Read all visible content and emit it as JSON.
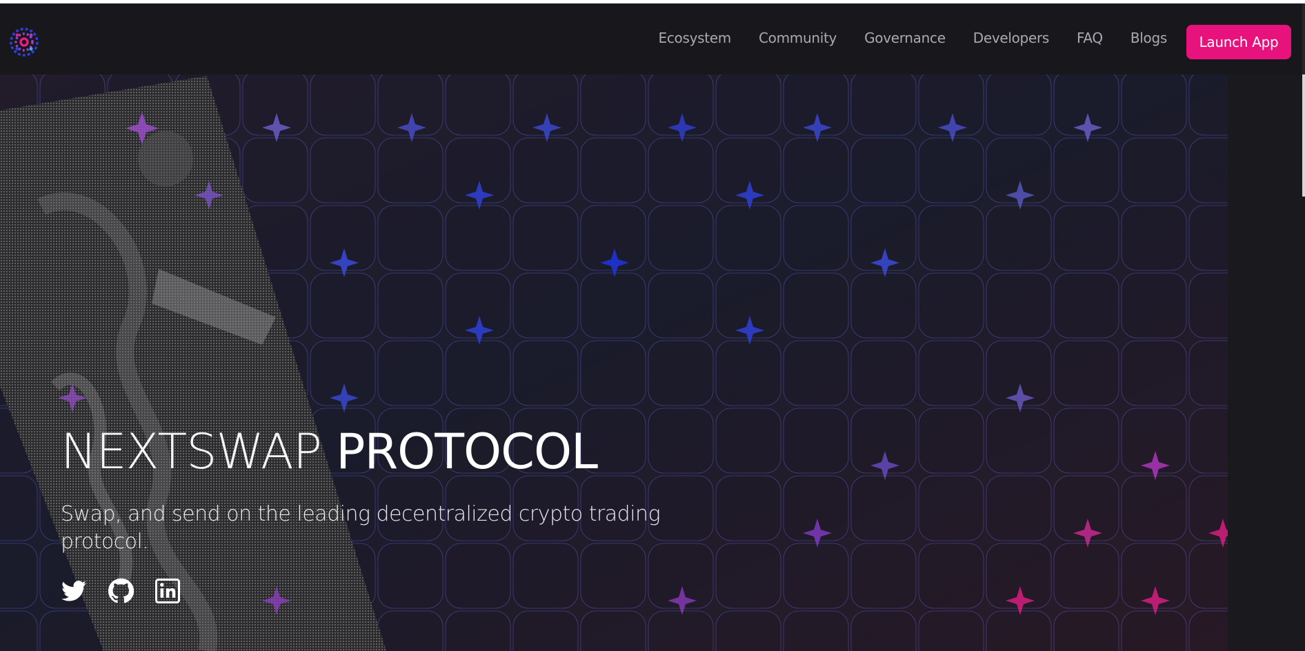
{
  "header": {
    "logo_icon": "nextswap-logo-icon",
    "nav": [
      {
        "label": "Ecosystem"
      },
      {
        "label": "Community"
      },
      {
        "label": "Governance"
      },
      {
        "label": "Developers"
      },
      {
        "label": "FAQ"
      },
      {
        "label": "Blogs"
      }
    ],
    "launch_label": "Launch App"
  },
  "hero": {
    "title_light": "NEXTSWAP",
    "title_bold": "PROTOCOL",
    "subtitle": "Swap, and send on the leading decentralized crypto trading protocol."
  },
  "socials": [
    {
      "icon": "twitter-icon"
    },
    {
      "icon": "github-icon"
    },
    {
      "icon": "linkedin-icon"
    }
  ],
  "colors": {
    "background": "#1a1a1e",
    "accent": "#e8127c",
    "grid_blue": "#2f3fd6",
    "grid_purple": "#8b3fd0",
    "grid_pink": "#e01e86",
    "nav_text": "#a9a9b1"
  }
}
